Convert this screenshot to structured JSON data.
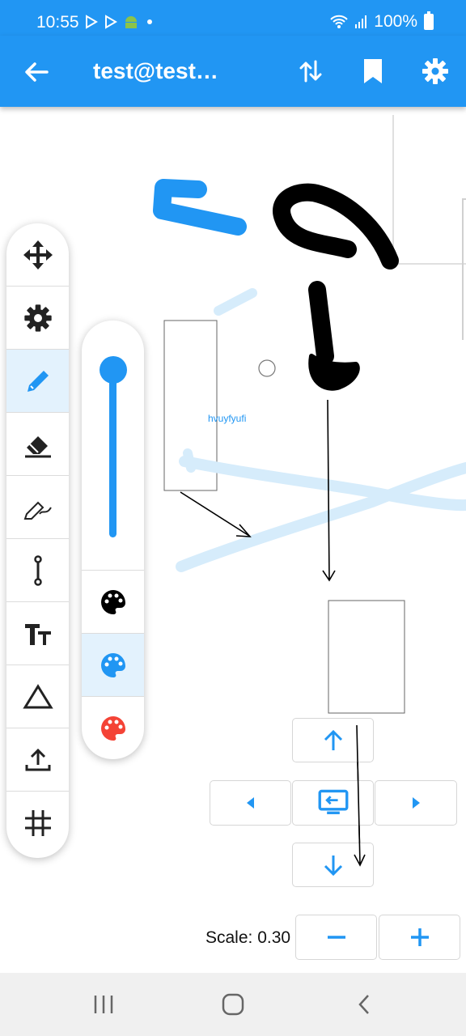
{
  "status_bar": {
    "time": "10:55",
    "battery": "100%"
  },
  "app_bar": {
    "title": "test@test…",
    "back_icon": "arrow-left-icon",
    "actions": [
      "swap-vertical-icon",
      "bookmark-icon",
      "gear-icon"
    ]
  },
  "canvas": {
    "text_annotation": "hvuyfyufi",
    "accent_color": "#2196f3"
  },
  "toolbar": {
    "tools": [
      {
        "id": "move",
        "icon": "move-icon"
      },
      {
        "id": "settings",
        "icon": "gear-icon"
      },
      {
        "id": "pen",
        "icon": "pencil-icon",
        "active": true
      },
      {
        "id": "eraser",
        "icon": "eraser-icon"
      },
      {
        "id": "highlighter",
        "icon": "highlighter-icon"
      },
      {
        "id": "line",
        "icon": "line-segment-icon"
      },
      {
        "id": "text",
        "icon": "text-size-icon"
      },
      {
        "id": "shape",
        "icon": "triangle-icon"
      },
      {
        "id": "export",
        "icon": "upload-icon"
      },
      {
        "id": "grid",
        "icon": "grid-icon"
      }
    ]
  },
  "color_panel": {
    "stroke_size_level": 0.0,
    "colors": [
      {
        "name": "black",
        "hex": "#000000"
      },
      {
        "name": "blue",
        "hex": "#2196f3",
        "active": true
      },
      {
        "name": "red",
        "hex": "#f44336"
      }
    ]
  },
  "zoom": {
    "label": "Scale: 0.30",
    "minus_icon": "minus-icon",
    "plus_icon": "plus-icon"
  },
  "navigation_bar": [
    "recent-apps-icon",
    "home-icon",
    "back-icon"
  ]
}
